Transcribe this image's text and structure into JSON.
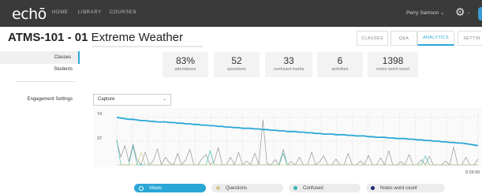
{
  "app": {
    "logo": "echō",
    "nav": [
      "HOME",
      "LIBRARY",
      "COURSES"
    ],
    "courses_caret": "⌄",
    "user_menu": "Perry Samson  ⌄",
    "gear_caret": "⌄"
  },
  "course": {
    "code": "ATMS-101 - 01",
    "name": " Extreme Weather"
  },
  "tabs": [
    "CLASSES",
    "Q&A",
    "ANALYTICS",
    "SETTIN"
  ],
  "sidebar": {
    "items": [
      "Classes",
      "Students",
      "Engagement Settings"
    ]
  },
  "stats": [
    {
      "value": "83%",
      "label": "attendance"
    },
    {
      "value": "52",
      "label": "questions"
    },
    {
      "value": "33",
      "label": "confused marks"
    },
    {
      "value": "6",
      "label": "activities"
    },
    {
      "value": "1398",
      "label": "notes word count"
    }
  ],
  "filter": {
    "selected": "Capture"
  },
  "legend": [
    "Views",
    "Questions",
    "Confused",
    "Notes word count"
  ],
  "colors": {
    "accent": "#2aa7d6",
    "views": "#2aa7d6",
    "questions": "#cfc98a",
    "confused": "#36b6b0",
    "notes": "#1f2a6e"
  },
  "chart_data": {
    "type": "line",
    "y_ticks": [
      "74",
      "37"
    ],
    "x_tick_end": "0:26:00",
    "ylim": [
      0,
      80
    ],
    "series": [
      {
        "name": "Views",
        "values": [
          74,
          73,
          72,
          71,
          71,
          70,
          69,
          69,
          68,
          68,
          67,
          67,
          67,
          66,
          66,
          65,
          65,
          64,
          64,
          63,
          63,
          62,
          62,
          61,
          61,
          60,
          60,
          59,
          59,
          58,
          58,
          57,
          57,
          57,
          56,
          56,
          55,
          55,
          54,
          54,
          53,
          53,
          52,
          52,
          52,
          51,
          51,
          50,
          50,
          49,
          49,
          48,
          48,
          48,
          47,
          47,
          47,
          46,
          46,
          45,
          45,
          45,
          44,
          44,
          43,
          43,
          43,
          42,
          42,
          41,
          41,
          41,
          40,
          40,
          39,
          39,
          38,
          38,
          37,
          37,
          36,
          36,
          35,
          35,
          34,
          34,
          33,
          32,
          31,
          30
        ]
      },
      {
        "name": "Notes word count",
        "values": [
          38,
          12,
          30,
          5,
          32,
          8,
          0,
          20,
          0,
          6,
          25,
          0,
          12,
          3,
          0,
          18,
          0,
          8,
          24,
          0,
          0,
          10,
          16,
          0,
          5,
          27,
          0,
          0,
          12,
          0,
          20,
          0,
          6,
          0,
          18,
          0,
          70,
          2,
          0,
          8,
          0,
          24,
          0,
          5,
          0,
          12,
          0,
          0,
          20,
          0,
          5,
          14,
          0,
          0,
          9,
          0,
          0,
          18,
          0,
          0,
          6,
          0,
          15,
          0,
          0,
          11,
          0,
          22,
          0,
          0,
          5,
          0,
          16,
          0,
          0,
          8,
          0,
          13,
          0,
          0,
          0,
          6,
          0,
          28,
          0,
          0,
          12,
          0,
          0,
          9
        ]
      },
      {
        "name": "Confused",
        "values": [
          40,
          0,
          0,
          0,
          30,
          0,
          0,
          0,
          0,
          0,
          0,
          0,
          0,
          0,
          0,
          0,
          0,
          0,
          0,
          0,
          0,
          0,
          0,
          22,
          0,
          0,
          0,
          0,
          0,
          0,
          0,
          0,
          0,
          0,
          0,
          0,
          0,
          0,
          0,
          0,
          0,
          18,
          0,
          0,
          0,
          0,
          0,
          0,
          0,
          0,
          0,
          0,
          0,
          0,
          0,
          0,
          0,
          0,
          0,
          0,
          0,
          0,
          0,
          0,
          0,
          0,
          0,
          0,
          0,
          0,
          0,
          0,
          0,
          0,
          0,
          0,
          14,
          0,
          0,
          0,
          0,
          0,
          0,
          0,
          0,
          0,
          0,
          0,
          0,
          0
        ]
      },
      {
        "name": "Questions",
        "values": [
          0,
          0,
          0,
          0,
          0,
          0,
          20,
          0,
          0,
          0,
          0,
          0,
          0,
          0,
          0,
          0,
          0,
          0,
          0,
          0,
          0,
          0,
          0,
          0,
          0,
          0,
          0,
          0,
          0,
          0,
          0,
          0,
          0,
          0,
          0,
          0,
          0,
          0,
          0,
          0,
          0,
          0,
          0,
          0,
          0,
          0,
          0,
          0,
          0,
          0,
          0,
          0,
          0,
          0,
          0,
          0,
          0,
          0,
          0,
          0,
          0,
          0,
          0,
          0,
          0,
          0,
          0,
          0,
          0,
          0,
          0,
          0,
          0,
          0,
          0,
          0,
          0,
          0,
          0,
          0,
          0,
          0,
          0,
          0,
          0,
          0,
          0,
          0,
          0,
          0
        ]
      }
    ]
  }
}
